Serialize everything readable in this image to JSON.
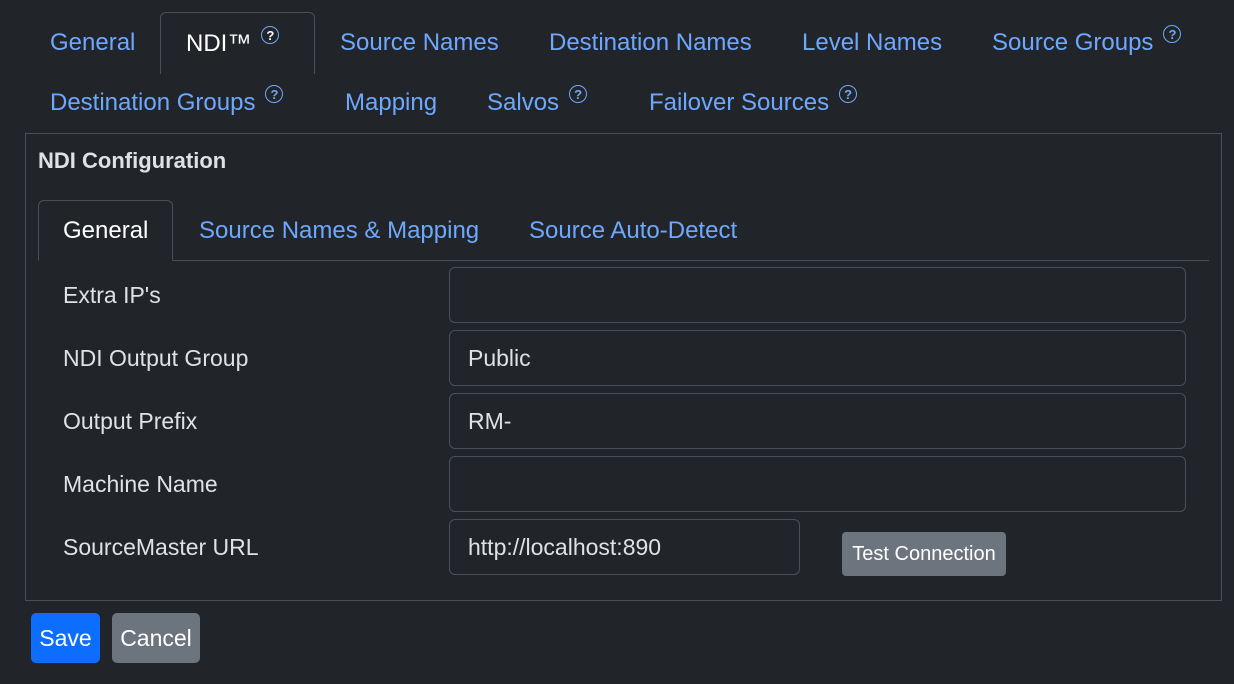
{
  "colors": {
    "background": "#212529",
    "link": "#6ea8fe",
    "border": "#495057",
    "primary": "#0d6efd",
    "secondary": "#6c757d",
    "text": "#dee2e6"
  },
  "tabs": [
    {
      "label": "General",
      "active": false,
      "help": false
    },
    {
      "label": "NDI™",
      "active": true,
      "help": true
    },
    {
      "label": "Source Names",
      "active": false,
      "help": false
    },
    {
      "label": "Destination Names",
      "active": false,
      "help": false
    },
    {
      "label": "Level Names",
      "active": false,
      "help": false
    },
    {
      "label": "Source Groups",
      "active": false,
      "help": true
    },
    {
      "label": "Destination Groups",
      "active": false,
      "help": true
    },
    {
      "label": "Mapping",
      "active": false,
      "help": false
    },
    {
      "label": "Salvos",
      "active": false,
      "help": true
    },
    {
      "label": "Failover Sources",
      "active": false,
      "help": true
    }
  ],
  "help_icon": {
    "name": "question-circle-icon",
    "glyph": "?"
  },
  "panel": {
    "title": "NDI Configuration",
    "subtabs": [
      {
        "label": "General",
        "active": true
      },
      {
        "label": "Source Names & Mapping",
        "active": false
      },
      {
        "label": "Source Auto-Detect",
        "active": false
      }
    ],
    "fields": [
      {
        "label": "Extra IP's",
        "value": ""
      },
      {
        "label": "NDI Output Group",
        "value": "Public"
      },
      {
        "label": "Output Prefix",
        "value": "RM-"
      },
      {
        "label": "Machine Name",
        "value": ""
      },
      {
        "label": "SourceMaster URL",
        "value": "http://localhost:890"
      }
    ],
    "test_button": "Test Connection"
  },
  "actions": {
    "save": "Save",
    "cancel": "Cancel"
  }
}
